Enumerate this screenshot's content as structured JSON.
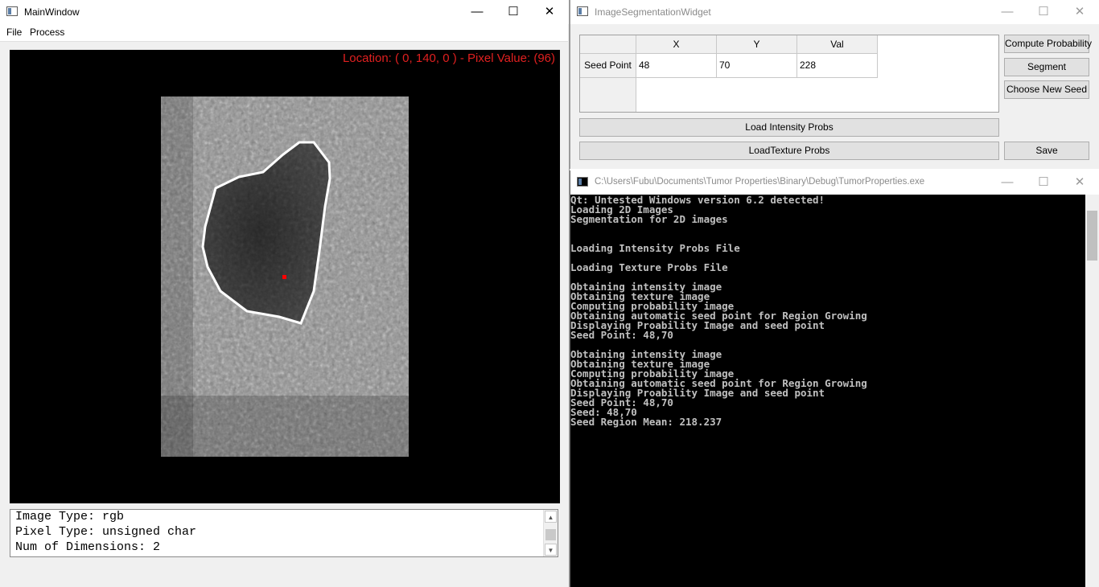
{
  "main_window": {
    "title": "MainWindow",
    "menu": [
      "File",
      "Process"
    ],
    "overlay": "Location: ( 0, 140, 0 ) - Pixel Value: (96)",
    "info_lines": [
      "Image Type: rgb",
      "Pixel Type: unsigned char",
      "Num of Dimensions: 2"
    ]
  },
  "seg_widget": {
    "title": "ImageSegmentationWidget",
    "columns": [
      "X",
      "Y",
      "Val"
    ],
    "row_header": "Seed Point",
    "values": [
      "48",
      "70",
      "228"
    ],
    "buttons": {
      "compute": "Compute Probability",
      "segment": "Segment",
      "choose_seed": "Choose New Seed",
      "save": "Save",
      "load_intensity": "Load Intensity Probs",
      "load_texture": "LoadTexture Probs"
    }
  },
  "console": {
    "title": "C:\\Users\\Fubu\\Documents\\Tumor Properties\\Binary\\Debug\\TumorProperties.exe",
    "text": "Qt: Untested Windows version 6.2 detected!\nLoading 2D Images\nSegmentation for 2D images\n\n\nLoading Intensity Probs File\n\nLoading Texture Probs File\n\nObtaining intensity image\nObtaining texture image\nComputing probability image\nObtaining automatic seed point for Region Growing\nDisplaying Proability Image and seed point\nSeed Point: 48,70\n\nObtaining intensity image\nObtaining texture image\nComputing probability image\nObtaining automatic seed point for Region Growing\nDisplaying Proability Image and seed point\nSeed Point: 48,70\nSeed: 48,70\nSeed Region Mean: 218.237"
  },
  "window_controls": {
    "minimize": "—",
    "maximize": "☐",
    "close": "✕"
  },
  "colors": {
    "overlay_text": "#e02020",
    "seed_marker": "#ff0000",
    "contour": "#ffffff",
    "console_bg": "#000000",
    "console_text": "#c0c0c0"
  }
}
